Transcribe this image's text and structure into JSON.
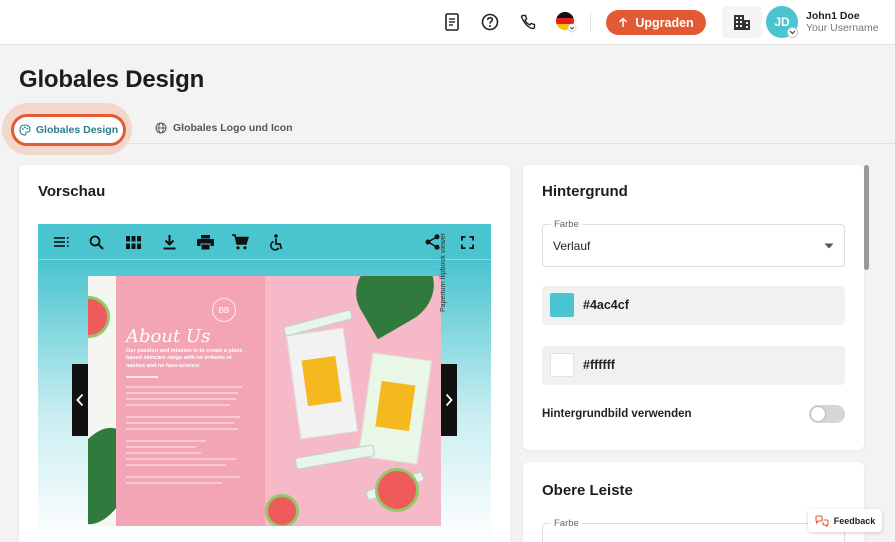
{
  "topbar": {
    "upgrade_label": "Upgraden",
    "avatar_initials": "JD",
    "user_name": "John1 Doe",
    "user_sub": "Your Username"
  },
  "page": {
    "title": "Globales Design",
    "tabs": [
      {
        "label": "Globales Design",
        "active": true
      },
      {
        "label": "Globales Logo und Icon",
        "active": false
      }
    ]
  },
  "preview": {
    "title": "Vorschau",
    "book": {
      "heading": "About Us",
      "tagline": "Our passion and mission is to create a plant-based skincare range with no irritants or nasties and no faux-science."
    },
    "watermark": "Paperturn flipbook viewer"
  },
  "background_panel": {
    "title": "Hintergrund",
    "color_label": "Farbe",
    "color_mode": "Verlauf",
    "color_1": "#4ac4cf",
    "color_2": "#ffffff",
    "bg_image_label": "Hintergrundbild verwenden",
    "bg_image_enabled": false
  },
  "top_bar_panel": {
    "title": "Obere Leiste",
    "color_label": "Farbe"
  },
  "feedback_label": "Feedback",
  "colors": {
    "accent": "#e25a33",
    "brand_teal": "#4ac4cf",
    "active_tab_text": "#2a7f8a"
  }
}
